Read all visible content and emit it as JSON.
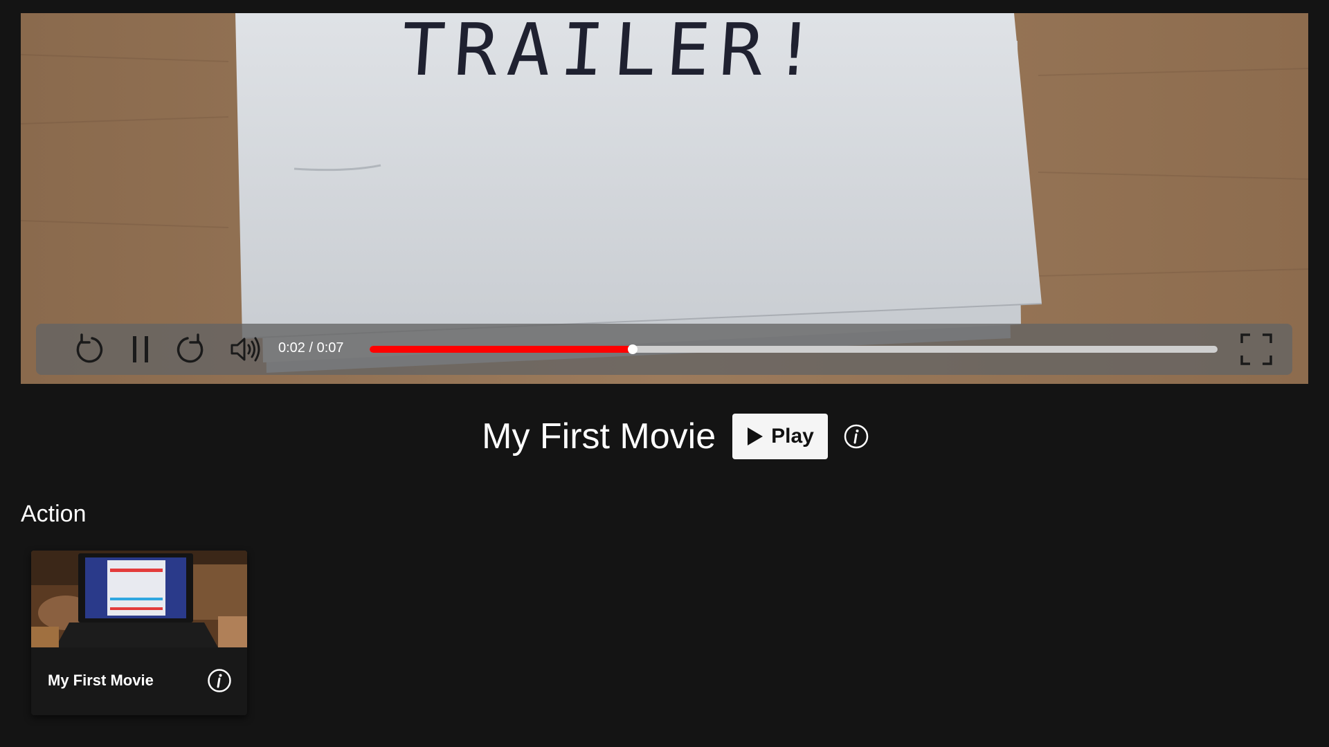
{
  "video": {
    "handwritten_text": "TRAILER!",
    "time_display": "0:02 / 0:07",
    "progress_fraction": 0.31,
    "colors": {
      "progress": "#ff0000",
      "track": "#cfcfcf",
      "bar_bg": "#646464"
    },
    "controls": {
      "rewind_icon": "rotate-ccw-icon",
      "pause_icon": "pause-icon",
      "forward_icon": "rotate-cw-icon",
      "volume_icon": "volume-icon",
      "fullscreen_icon": "fullscreen-icon"
    }
  },
  "hero": {
    "title": "My First Movie",
    "play_label": "Play",
    "play_icon": "play-icon",
    "info_icon": "info-icon"
  },
  "category": {
    "heading": "Action",
    "items": [
      {
        "title": "My First Movie",
        "info_icon": "info-icon"
      }
    ]
  },
  "theme": {
    "background": "#141414",
    "card": "#181818",
    "text": "#ffffff"
  }
}
